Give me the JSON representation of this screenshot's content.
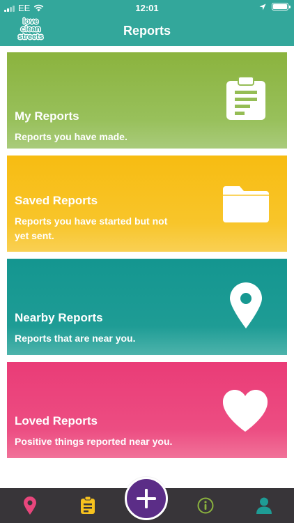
{
  "status_bar": {
    "carrier": "EE",
    "time": "12:01"
  },
  "header": {
    "logo_lines": [
      "love",
      "clean",
      "streets"
    ],
    "title": "Reports"
  },
  "cards": [
    {
      "title": "My Reports",
      "subtitle": "Reports you have made.",
      "icon": "clipboard-icon"
    },
    {
      "title": "Saved Reports",
      "subtitle_lines": [
        "Reports you have started but not",
        "yet sent."
      ],
      "icon": "folder-icon"
    },
    {
      "title": "Nearby Reports",
      "subtitle": "Reports that are near you.",
      "icon": "map-pin-icon"
    },
    {
      "title": "Loved Reports",
      "subtitle": "Positive things reported near you.",
      "icon": "heart-icon"
    }
  ],
  "tab_bar": {
    "items": [
      {
        "icon": "map-pin-icon",
        "color": "#e8467c"
      },
      {
        "icon": "clipboard-icon",
        "color": "#f7c21e"
      },
      {
        "icon": "plus-icon",
        "color": "#5b2d87"
      },
      {
        "icon": "info-icon",
        "color": "#8bb33e"
      },
      {
        "icon": "user-icon",
        "color": "#1e9c95"
      }
    ]
  },
  "colors": {
    "teal": "#33a79b",
    "green": "#8bb33e",
    "yellow": "#f7bc12",
    "pink": "#ea3c77",
    "purple": "#5b2d87",
    "tab_bg": "#383539"
  }
}
